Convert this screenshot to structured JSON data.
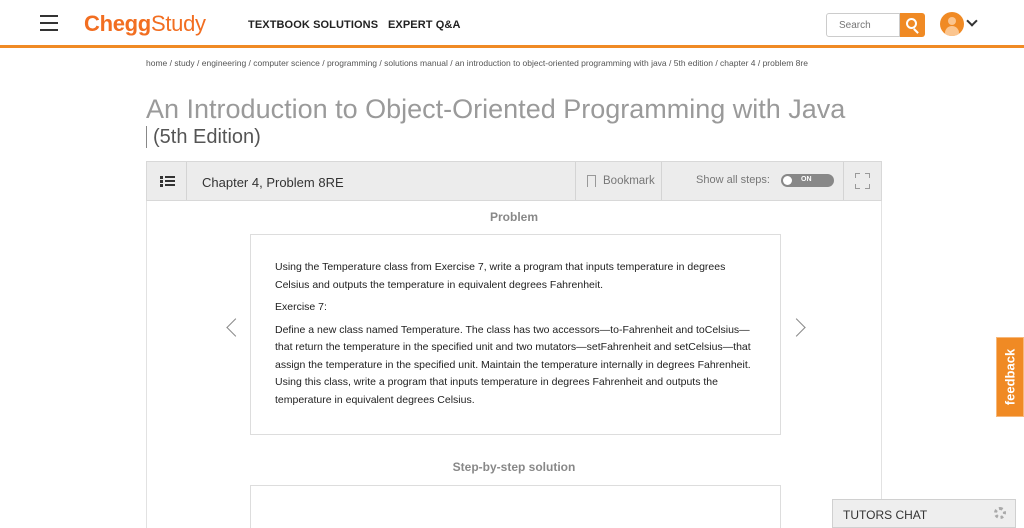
{
  "header": {
    "logo_brand": "Chegg",
    "logo_product": "Study",
    "nav": [
      "TEXTBOOK SOLUTIONS",
      "EXPERT Q&A"
    ],
    "search_placeholder": "Search"
  },
  "breadcrumb": "home / study / engineering / computer science / programming / solutions manual / an introduction to object-oriented programming with java / 5th edition / chapter 4 / problem 8re",
  "book": {
    "title": "An Introduction to Object-Oriented Programming with Java",
    "edition": "(5th Edition)"
  },
  "toolbar": {
    "chapter_problem": "Chapter 4, Problem 8RE",
    "bookmark_label": "Bookmark",
    "show_steps_label": "Show all steps:",
    "toggle_label": "ON"
  },
  "problem": {
    "heading": "Problem",
    "paragraphs": [
      "Using the Temperature class from Exercise 7, write a program that inputs temperature in degrees Celsius and outputs the temperature in equivalent degrees Fahrenheit.",
      "Exercise 7:",
      "Define a new class named Temperature. The class has two accessors—to-Fahrenheit and toCelsius—that return the temperature in the specified unit and two mutators—setFahrenheit and setCelsius—that assign the temperature in the specified unit. Maintain the temperature internally in degrees Fahrenheit. Using this class, write a program that inputs temperature in degrees Fahrenheit and outputs the temperature in equivalent degrees Celsius."
    ]
  },
  "solution": {
    "heading": "Step-by-step solution"
  },
  "feedback_label": "feedback",
  "tutors_chat_label": "TUTORS CHAT",
  "colors": {
    "brand_orange": "#f08a24",
    "title_gray": "#9a9a9a"
  },
  "icons": [
    "menu-icon",
    "search-icon",
    "avatar-icon",
    "chevron-down-icon",
    "list-icon",
    "bookmark-icon",
    "expand-icon",
    "chevron-left-icon",
    "chevron-right-icon",
    "gear-icon"
  ]
}
